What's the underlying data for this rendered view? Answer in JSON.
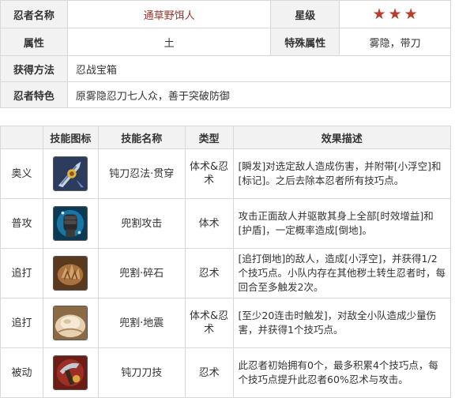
{
  "info": {
    "name_label": "忍者名称",
    "name_value": "通草野饵人",
    "star_label": "星级",
    "star_count": 3,
    "star_color": "#b83d2c",
    "attr_label": "属性",
    "attr_value": "土",
    "special_label": "特殊属性",
    "special_value": "雾隐，带刀",
    "obtain_label": "获得方法",
    "obtain_value": "忍战宝箱",
    "feature_label": "忍者特色",
    "feature_value": "原雾隐忍刀七人众，善于突破防御"
  },
  "skills": {
    "headers": [
      "技能图标",
      "技能名称",
      "类型",
      "效果描述"
    ],
    "rows": [
      {
        "category": "奥义",
        "icon": "blade-pierce-icon",
        "name": "钝刀忍法·贯穿",
        "type": "体术&忍术",
        "desc": "[瞬发]对选定敌人造成伤害，并附带[小浮空]和[标记]。之后去除本忍者所有技巧点。"
      },
      {
        "category": "普攻",
        "icon": "fist-icon",
        "name": "兜割攻击",
        "type": "体术",
        "desc": "攻击正面敌人并驱散其身上全部[时效增益]和[护盾]，一定概率造成[倒地]。"
      },
      {
        "category": "追打",
        "icon": "rock-burst-icon",
        "name": "兜割·碎石",
        "type": "忍术",
        "desc": "[追打倒地]的敌人，造成[小浮空]，并获得1/2个技巧点。小队内存在其他秽土转生忍者时，每回合至多触发2次。"
      },
      {
        "category": "追打",
        "icon": "earthquake-icon",
        "name": "兜割·地震",
        "type": "体术&忍术",
        "desc": "[至少20连击时触发]，对敌全小队造成少量伤害，并获得1个技巧点。"
      },
      {
        "category": "被动",
        "icon": "blunt-blade-icon",
        "name": "钝刀刀技",
        "type": "忍术",
        "desc": "此忍者初始拥有0个，最多积累4个技巧点，每个技巧点提升此忍者60%忍术与攻击。"
      }
    ]
  }
}
